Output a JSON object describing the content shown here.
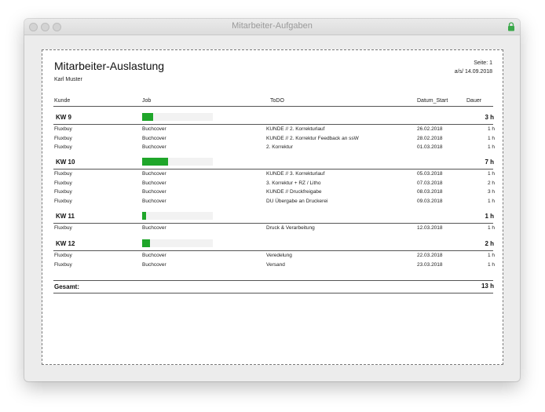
{
  "window": {
    "title": "Mitarbeiter-Aufgaben"
  },
  "report": {
    "title": "Mitarbeiter-Auslastung",
    "employee": "Karl Muster",
    "page_label": "Seite: 1",
    "as_of": "a/s/  14.09.2018",
    "columns": {
      "kunde": "Kunde",
      "job": "Job",
      "todo": "ToDO",
      "datum": "Datum_Start",
      "dauer": "Dauer"
    },
    "weeks": [
      {
        "label": "KW 9",
        "total": "3 h",
        "fill": 0.16,
        "rows": [
          {
            "kunde": "Fluxbuy",
            "job": "Buchcover",
            "todo": "KUNDE // 2. Korrekturlauf",
            "datum": "26.02.2018",
            "dauer": "1 h"
          },
          {
            "kunde": "Fluxbuy",
            "job": "Buchcover",
            "todo": "KUNDE // 2. Korrektur Feedback an ssW",
            "datum": "28.02.2018",
            "dauer": "1 h"
          },
          {
            "kunde": "Fluxbuy",
            "job": "Buchcover",
            "todo": " 2. Korrektur",
            "datum": "01.03.2018",
            "dauer": "1 h"
          }
        ]
      },
      {
        "label": "KW 10",
        "total": "7 h",
        "fill": 0.37,
        "rows": [
          {
            "kunde": "Fluxbuy",
            "job": "Buchcover",
            "todo": "KUNDE // 3. Korrekturlauf",
            "datum": "05.03.2018",
            "dauer": "1 h"
          },
          {
            "kunde": "Fluxbuy",
            "job": "Buchcover",
            "todo": " 3. Korrektur + RZ / Litho",
            "datum": "07.03.2018",
            "dauer": "2 h"
          },
          {
            "kunde": "Fluxbuy",
            "job": "Buchcover",
            "todo": "KUNDE // Druckfreigabe",
            "datum": "08.03.2018",
            "dauer": "3 h"
          },
          {
            "kunde": "Fluxbuy",
            "job": "Buchcover",
            "todo": "DU Übergabe an Druckerei",
            "datum": "09.03.2018",
            "dauer": "1 h"
          }
        ]
      },
      {
        "label": "KW 11",
        "total": "1 h",
        "fill": 0.06,
        "rows": [
          {
            "kunde": "Fluxbuy",
            "job": "Buchcover",
            "todo": "Druck & Verarbeitung",
            "datum": "12.03.2018",
            "dauer": "1 h"
          }
        ]
      },
      {
        "label": "KW 12",
        "total": "2 h",
        "fill": 0.11,
        "rows": [
          {
            "kunde": "Fluxbuy",
            "job": "Buchcover",
            "todo": "Veredelung",
            "datum": "22.03.2018",
            "dauer": "1 h"
          },
          {
            "kunde": "Fluxbuy",
            "job": "Buchcover",
            "todo": "Versand",
            "datum": "23.03.2018",
            "dauer": "1 h"
          }
        ]
      }
    ],
    "gesamt_label": "Gesamt:",
    "gesamt_total": "13 h"
  },
  "colors": {
    "bar": "#1fa62a",
    "bar_bg": "#f2f2f2",
    "lock": "#3aa84a"
  }
}
